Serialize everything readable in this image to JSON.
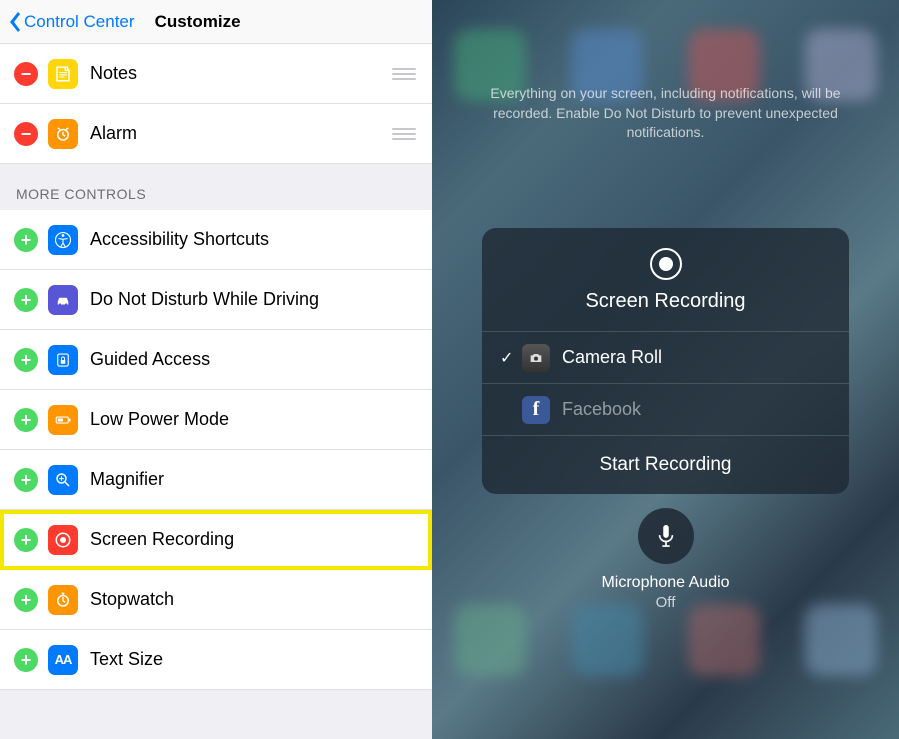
{
  "nav": {
    "back": "Control Center",
    "title": "Customize"
  },
  "included": [
    {
      "label": "Notes",
      "icon": "notes"
    },
    {
      "label": "Alarm",
      "icon": "alarm"
    }
  ],
  "more_header": "MORE CONTROLS",
  "more": [
    {
      "label": "Accessibility Shortcuts",
      "icon": "acc"
    },
    {
      "label": "Do Not Disturb While Driving",
      "icon": "dnd"
    },
    {
      "label": "Guided Access",
      "icon": "guided"
    },
    {
      "label": "Low Power Mode",
      "icon": "lpm"
    },
    {
      "label": "Magnifier",
      "icon": "mag"
    },
    {
      "label": "Screen Recording",
      "icon": "screenrec",
      "highlight": true
    },
    {
      "label": "Stopwatch",
      "icon": "stopwatch"
    },
    {
      "label": "Text Size",
      "icon": "text"
    }
  ],
  "cc": {
    "notice": "Everything on your screen, including notifications, will be recorded. Enable Do Not Disturb to prevent unexpected notifications.",
    "panel_title": "Screen Recording",
    "options": [
      {
        "label": "Camera Roll",
        "selected": true,
        "kind": "cam"
      },
      {
        "label": "Facebook",
        "selected": false,
        "kind": "fb"
      }
    ],
    "start": "Start Recording",
    "mic_label": "Microphone Audio",
    "mic_state": "Off"
  }
}
